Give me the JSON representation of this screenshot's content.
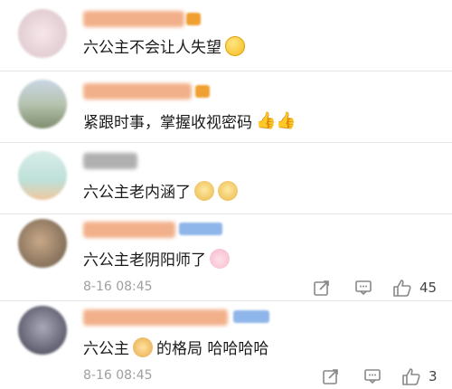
{
  "comments": [
    {
      "text": "六公主不会让人失望",
      "emoji": "smile-emoji"
    },
    {
      "text": "紧跟时事，掌握收视密码",
      "emoji": "thumbs-up-emoji"
    },
    {
      "text": "六公主老内涵了",
      "emoji": "doge-emoji"
    },
    {
      "text": "六公主老阴阳师了",
      "emoji": "bunny-emoji",
      "date": "8-16 08:45",
      "likes": "45"
    },
    {
      "text_before": "六公主",
      "text_after": "的格局 哈哈哈哈",
      "emoji": "girl-emoji",
      "date": "8-16 08:45",
      "likes": "3"
    }
  ],
  "colors": {
    "name": "#ef9a64",
    "text": "#1a1a1a",
    "meta": "#a0a0a0"
  }
}
